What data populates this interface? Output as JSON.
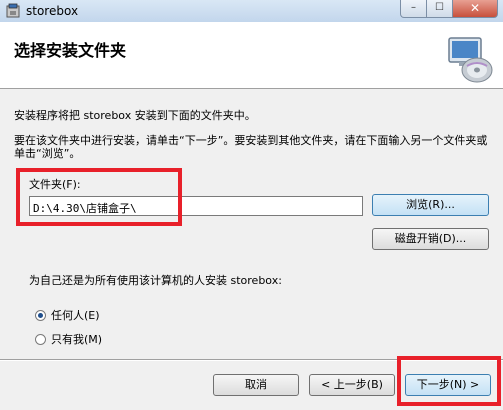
{
  "window": {
    "title": "storebox",
    "minimize_glyph": "–",
    "maximize_glyph": "☐",
    "close_glyph": "✕"
  },
  "header": {
    "title": "选择安装文件夹",
    "icon": "computer-disc-icon"
  },
  "body": {
    "intro": "安装程序将把 storebox 安装到下面的文件夹中。",
    "instruction": "要在该文件夹中进行安装，请单击“下一步”。要安装到其他文件夹，请在下面输入另一个文件夹或单击“浏览”。",
    "folder_label": "文件夹(F):",
    "folder_value": "D:\\4.30\\店铺盒子\\",
    "browse_label": "浏览(R)...",
    "disk_cost_label": "磁盘开销(D)...",
    "user_question": "为自己还是为所有使用该计算机的人安装 storebox:",
    "radio_options": [
      {
        "label": "任何人(E)",
        "checked": true
      },
      {
        "label": "只有我(M)",
        "checked": false
      }
    ]
  },
  "footer": {
    "cancel_label": "取消",
    "back_label": "< 上一步(B)",
    "next_label": "下一步(N) >"
  },
  "colors": {
    "highlight": "#e8202a"
  }
}
